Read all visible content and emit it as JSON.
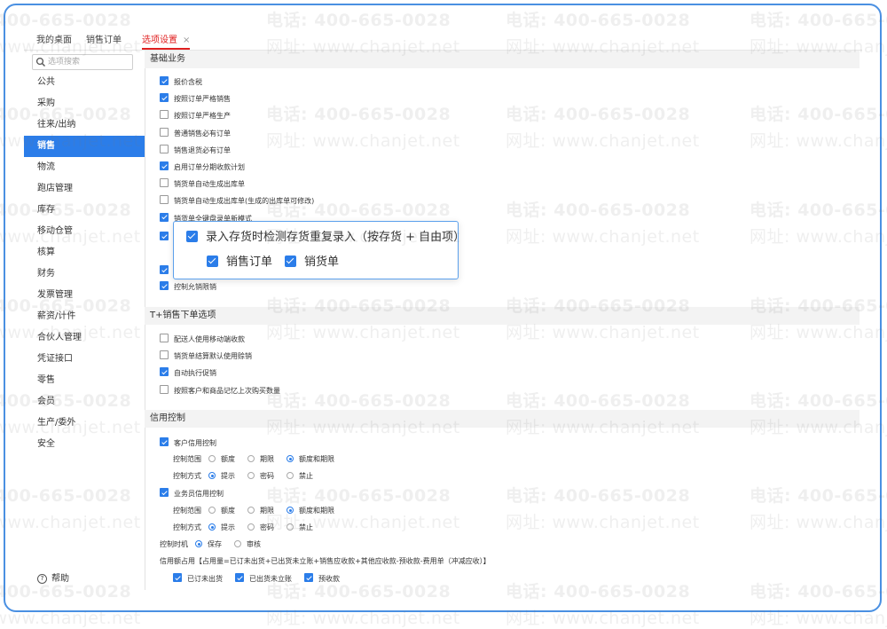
{
  "tabs": [
    {
      "label": "我的桌面"
    },
    {
      "label": "销售订单"
    },
    {
      "label": "选项设置",
      "close": "×"
    }
  ],
  "sidebar": {
    "search_placeholder": "选项搜索",
    "items": [
      "公共",
      "采购",
      "往来/出纳",
      "销售",
      "物流",
      "跑店管理",
      "库存",
      "移动仓管",
      "核算",
      "财务",
      "发票管理",
      "薪资/计件",
      "合伙人管理",
      "凭证接口",
      "零售",
      "会员",
      "生产/委外",
      "安全"
    ],
    "active_index": 3,
    "help": "帮助"
  },
  "sections": {
    "basic": {
      "title": "基础业务",
      "options": [
        {
          "label": "报价含税",
          "checked": true
        },
        {
          "label": "按照订单严格销售",
          "checked": true
        },
        {
          "label": "按照订单严格生产",
          "checked": false
        },
        {
          "label": "普通销售必有订单",
          "checked": false
        },
        {
          "label": "销售退货必有订单",
          "checked": false
        },
        {
          "label": "启用订单分期收款计划",
          "checked": true
        },
        {
          "label": "销货单自动生成出库单",
          "checked": false
        },
        {
          "label": "销货单自动生成出库单(生成的出库单可修改)",
          "checked": false
        },
        {
          "label": "销货单全键盘录单新模式",
          "checked": true
        },
        {
          "label": "控制允销限销",
          "checked": true
        }
      ]
    },
    "tplus": {
      "title": "T+销售下单选项",
      "options": [
        {
          "label": "配送人使用移动端收款",
          "checked": false
        },
        {
          "label": "销货单结算默认使用赊销",
          "checked": false
        },
        {
          "label": "自动执行促销",
          "checked": true
        },
        {
          "label": "按照客户和商品记忆上次购买数量",
          "checked": false
        }
      ]
    },
    "credit": {
      "title": "信用控制",
      "customer": {
        "label": "客户信用控制",
        "checked": true,
        "range_label": "控制范围",
        "range_options": [
          "额度",
          "期限",
          "额度和期限"
        ],
        "range_selected": 2,
        "mode_label": "控制方式",
        "mode_options": [
          "提示",
          "密码",
          "禁止"
        ],
        "mode_selected": 0
      },
      "salesman": {
        "label": "业务员信用控制",
        "checked": true,
        "range_label": "控制范围",
        "range_options": [
          "额度",
          "期限",
          "额度和期限"
        ],
        "range_selected": 2,
        "mode_label": "控制方式",
        "mode_options": [
          "提示",
          "密码",
          "禁止"
        ],
        "mode_selected": 0
      },
      "timing": {
        "label": "控制时机",
        "options": [
          "保存",
          "审核"
        ],
        "selected": 0
      },
      "formula": "信用额占用【占用量=已订未出货+已出货未立账+销售应收款+其他应收款-预收款-费用单（冲减应收）】",
      "formula_items": [
        {
          "label": "已订未出货",
          "checked": true
        },
        {
          "label": "已出货未立账",
          "checked": true
        },
        {
          "label": "预收款",
          "checked": true
        }
      ]
    }
  },
  "popup": {
    "main": {
      "label": "录入存货时检测存货重复录入（按存货 + 自由项）",
      "checked": true
    },
    "subs": [
      {
        "label": "销售订单",
        "checked": true
      },
      {
        "label": "销货单",
        "checked": true
      }
    ]
  },
  "watermark": {
    "phone": "电话: 400-665-0028",
    "site": "网址: www.chanjet.net"
  },
  "colors": {
    "accent": "#2b7de9",
    "active_tab": "#e02020",
    "frame": "#4a90e2"
  }
}
